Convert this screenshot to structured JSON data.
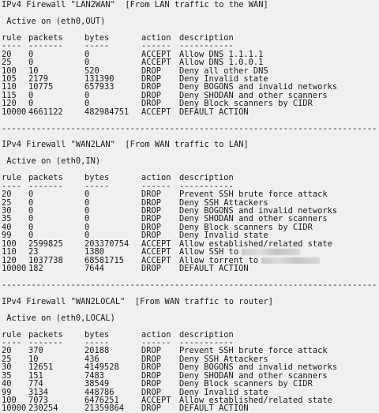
{
  "sections": [
    {
      "title": "IPv4 Firewall \"LAN2WAN\"  [From LAN traffic to the WAN]",
      "active": " Active on (eth0,OUT)",
      "headers": [
        "rule",
        "packets",
        "bytes",
        "action",
        "description"
      ],
      "underlines": [
        "----",
        "-------",
        "-----",
        "------",
        "-----------"
      ],
      "rows": [
        {
          "rule": "20",
          "packets": "0",
          "bytes": "0",
          "action": "ACCEPT",
          "description": "Allow DNS 1.1.1.1"
        },
        {
          "rule": "25",
          "packets": "0",
          "bytes": "0",
          "action": "ACCEPT",
          "description": "Allow DNS 1.0.0.1"
        },
        {
          "rule": "100",
          "packets": "10",
          "bytes": "520",
          "action": "DROP",
          "description": "Deny all other DNS"
        },
        {
          "rule": "105",
          "packets": "2179",
          "bytes": "131390",
          "action": "DROP",
          "description": "Deny Invalid state"
        },
        {
          "rule": "110",
          "packets": "10775",
          "bytes": "657933",
          "action": "DROP",
          "description": "Deny BOGONS and invalid networks"
        },
        {
          "rule": "115",
          "packets": "0",
          "bytes": "0",
          "action": "DROP",
          "description": "Deny SHODAN and other scanners"
        },
        {
          "rule": "120",
          "packets": "0",
          "bytes": "0",
          "action": "DROP",
          "description": "Deny Block scanners by CIDR"
        },
        {
          "rule": "10000",
          "packets": "4661122",
          "bytes": "482984751",
          "action": "ACCEPT",
          "description": "DEFAULT ACTION"
        }
      ]
    },
    {
      "title": "IPv4 Firewall \"WAN2LAN\"  [From WAN traffic to LAN]",
      "active": " Active on (eth0,IN)",
      "headers": [
        "rule",
        "packets",
        "bytes",
        "action",
        "description"
      ],
      "underlines": [
        "----",
        "-------",
        "-----",
        "------",
        "-----------"
      ],
      "rows": [
        {
          "rule": "20",
          "packets": "0",
          "bytes": "0",
          "action": "DROP",
          "description": "Prevent SSH brute force attack"
        },
        {
          "rule": "25",
          "packets": "0",
          "bytes": "0",
          "action": "DROP",
          "description": "Deny SSH Attackers"
        },
        {
          "rule": "30",
          "packets": "0",
          "bytes": "0",
          "action": "DROP",
          "description": "Deny BOGONS and invalid networks"
        },
        {
          "rule": "35",
          "packets": "0",
          "bytes": "0",
          "action": "DROP",
          "description": "Deny SHODAN and other scanners"
        },
        {
          "rule": "40",
          "packets": "0",
          "bytes": "0",
          "action": "DROP",
          "description": "Deny Block scanners by CIDR"
        },
        {
          "rule": "99",
          "packets": "0",
          "bytes": "0",
          "action": "DROP",
          "description": "Deny Invalid state"
        },
        {
          "rule": "100",
          "packets": "2599825",
          "bytes": "203370754",
          "action": "ACCEPT",
          "description": "Allow established/related state"
        },
        {
          "rule": "110",
          "packets": "23",
          "bytes": "1380",
          "action": "ACCEPT",
          "description": "Allow SSH to",
          "redacted": true
        },
        {
          "rule": "120",
          "packets": "1037738",
          "bytes": "68581715",
          "action": "ACCEPT",
          "description": "Allow torrent to",
          "redacted": true
        },
        {
          "rule": "10000",
          "packets": "182",
          "bytes": "7644",
          "action": "DROP",
          "description": "DEFAULT ACTION"
        }
      ]
    },
    {
      "title": "IPv4 Firewall \"WAN2LOCAL\"  [From WAN traffic to router]",
      "active": " Active on (eth0,LOCAL)",
      "headers": [
        "rule",
        "packets",
        "bytes",
        "action",
        "description"
      ],
      "underlines": [
        "----",
        "-------",
        "-----",
        "------",
        "-----------"
      ],
      "rows": [
        {
          "rule": "20",
          "packets": "370",
          "bytes": "20188",
          "action": "DROP",
          "description": "Prevent SSH brute force attack"
        },
        {
          "rule": "25",
          "packets": "10",
          "bytes": "436",
          "action": "DROP",
          "description": "Deny SSH Attackers"
        },
        {
          "rule": "30",
          "packets": "12651",
          "bytes": "4149528",
          "action": "DROP",
          "description": "Deny BOGONS and invalid networks"
        },
        {
          "rule": "35",
          "packets": "151",
          "bytes": "7483",
          "action": "DROP",
          "description": "Deny SHODAN and other scanners"
        },
        {
          "rule": "40",
          "packets": "774",
          "bytes": "38549",
          "action": "DROP",
          "description": "Deny Block scanners by CIDR"
        },
        {
          "rule": "99",
          "packets": "3134",
          "bytes": "448786",
          "action": "DROP",
          "description": "Deny Invalid state"
        },
        {
          "rule": "100",
          "packets": "7073",
          "bytes": "6476251",
          "action": "ACCEPT",
          "description": "Allow established/related state"
        },
        {
          "rule": "10000",
          "packets": "230254",
          "bytes": "21359864",
          "action": "DROP",
          "description": "DEFAULT ACTION"
        }
      ]
    }
  ],
  "separator": "---------------------------------------------------------------------------------"
}
